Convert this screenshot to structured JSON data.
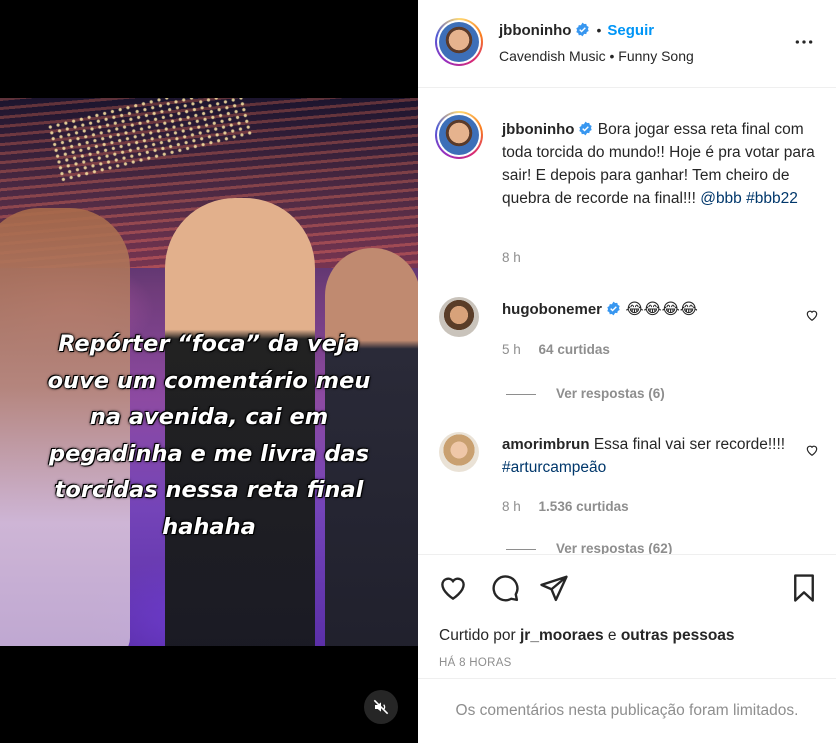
{
  "media": {
    "overlay_lines": [
      "Repórter “foca” da veja",
      "ouve um comentário meu",
      "na avenida, cai em",
      "pegadinha e me livra das",
      "torcidas nessa reta final",
      "hahaha"
    ]
  },
  "header": {
    "username": "jbboninho",
    "follow_label": "Seguir",
    "audio": "Cavendish Music",
    "audio_separator": "•",
    "song": "Funny Song"
  },
  "caption": {
    "username": "jbboninho",
    "text": "Bora jogar essa reta final com toda torcida do mundo!! Hoje é pra votar para sair! E depois para ganhar! Tem cheiro de quebra de recorde na final!!!",
    "tags": [
      "@bbb",
      "#bbb22"
    ],
    "time": "8 h"
  },
  "comments": [
    {
      "username": "hugobonemer",
      "text": "😂😂😂😂",
      "time": "5 h",
      "likes": "64 curtidas",
      "replies": "Ver respostas (6)"
    },
    {
      "username": "amorimbrun",
      "text": "Essa final vai ser recorde!!!!",
      "tag": "#arturcampeão",
      "time": "8 h",
      "likes": "1.536 curtidas",
      "replies": "Ver respostas (62)"
    }
  ],
  "likes_line": {
    "prefix": "Curtido por",
    "user": "jr_mooraes",
    "connector": "e",
    "others": "outras pessoas"
  },
  "posted_time": "HÁ 8 HORAS",
  "comments_limited": "Os comentários nesta publicação foram limitados.",
  "colors": {
    "link": "#00376b",
    "follow": "#0095f6",
    "verified": "#3897f0",
    "muted": "#8e8e8e"
  }
}
